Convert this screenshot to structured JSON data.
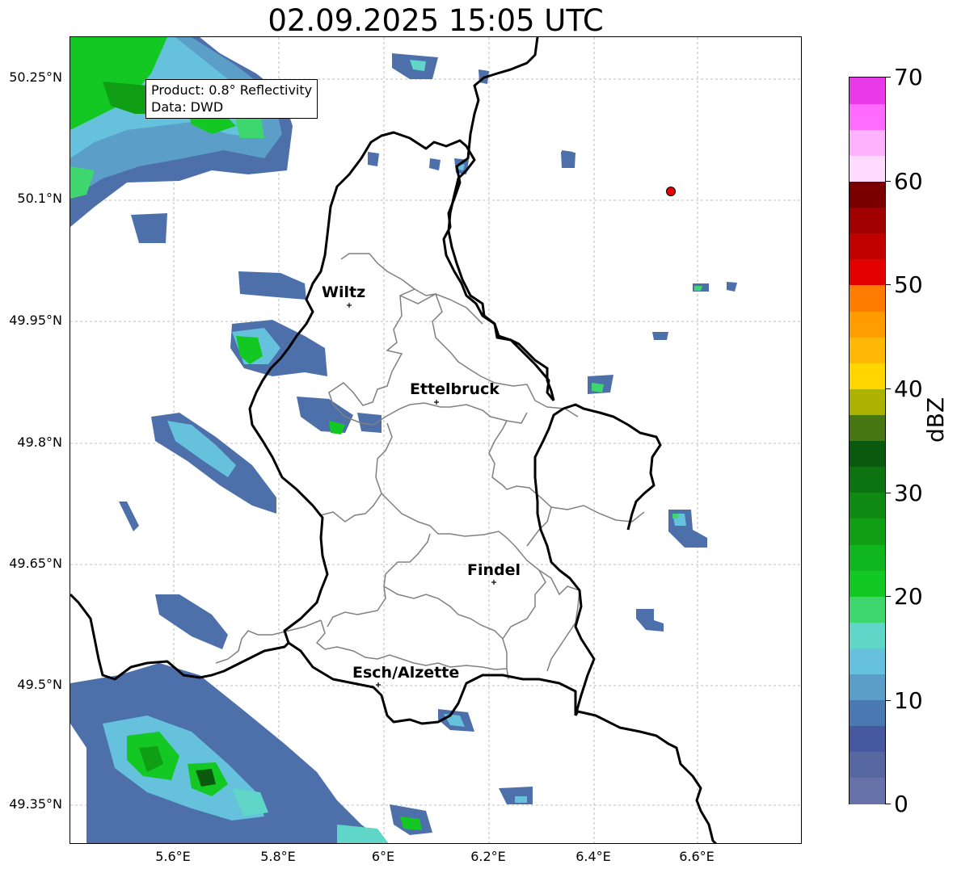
{
  "title": "02.09.2025 15:05 UTC",
  "info": {
    "product": "Product: 0.8° Reflectivity",
    "source": "Data: DWD"
  },
  "y_ticks": [
    "50.25°N",
    "50.1°N",
    "49.95°N",
    "49.8°N",
    "49.65°N",
    "49.5°N",
    "49.35°N"
  ],
  "x_ticks": [
    "5.6°E",
    "5.8°E",
    "6°E",
    "6.2°E",
    "6.4°E",
    "6.6°E"
  ],
  "cities": [
    {
      "name": "Wiltz",
      "lon": 5.93,
      "lat": 49.97
    },
    {
      "name": "Ettelbruck",
      "lon": 6.1,
      "lat": 49.85
    },
    {
      "name": "Findel",
      "lon": 6.21,
      "lat": 49.627
    },
    {
      "name": "Esch/Alzette",
      "lon": 5.99,
      "lat": 49.5
    }
  ],
  "radar_site": {
    "lon": 6.547,
    "lat": 50.111,
    "color": "#e60000"
  },
  "colorbar": {
    "unit": "dBZ",
    "min": 0,
    "max": 70,
    "labels": [
      "70",
      "60",
      "50",
      "40",
      "30",
      "20",
      "10",
      "0"
    ],
    "colors": [
      "#6672a8",
      "#56689f",
      "#4659a0",
      "#4a78b0",
      "#5b9fc8",
      "#66c1dd",
      "#5fd6c8",
      "#3ed76d",
      "#13c823",
      "#10b61d",
      "#0f9e14",
      "#0f8a12",
      "#0d7310",
      "#095a0e",
      "#477612",
      "#adb100",
      "#ffd600",
      "#ffb806",
      "#ff9c00",
      "#ff7c00",
      "#e30000",
      "#c10000",
      "#a00000",
      "#7a0000",
      "#ffdcff",
      "#ffb3ff",
      "#ff6bff",
      "#e83ae8"
    ]
  }
}
